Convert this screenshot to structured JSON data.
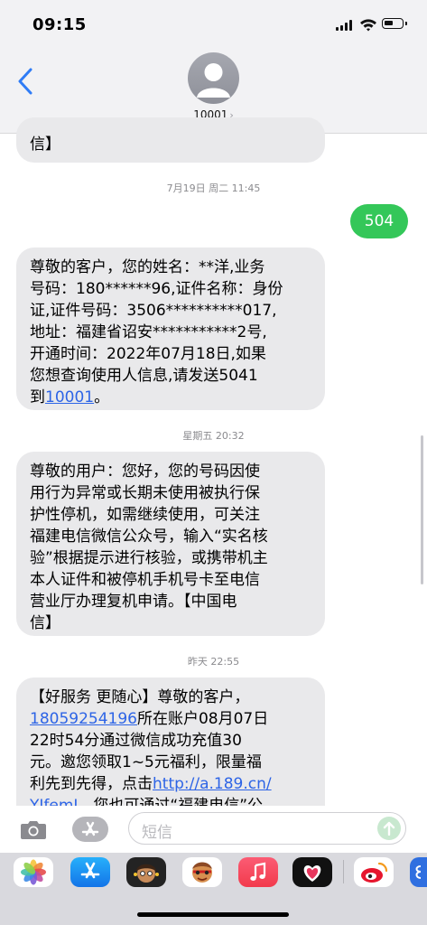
{
  "status_bar": {
    "time": "09:15"
  },
  "header": {
    "contact_name": "10001",
    "contact_chevron": "›"
  },
  "messages": {
    "partial_top": "信】",
    "timestamp_1": "7月19日 周二 11:45",
    "outgoing_1": "504",
    "incoming_1": {
      "lines": [
        "尊敬的客户，您的姓名：**洋,业务",
        "号码：180******96,证件名称：身份",
        "证,证件号码：3506**********017,",
        "地址：福建省诏安***********2号,",
        "开通时间：2022年07月18日,如果",
        "您想查询使用人信息,请发送5041"
      ],
      "last_prefix": "到",
      "last_link": "10001",
      "last_suffix": "。"
    },
    "timestamp_2": "星期五 20:32",
    "incoming_2": {
      "lines": [
        "尊敬的用户：您好，您的号码因使",
        "用行为异常或长期未使用被执行保",
        "护性停机，如需继续使用，可关注",
        "福建电信微信公众号，输入“实名核",
        "验”根据提示进行核验，或携带机主",
        "本人证件和被停机手机号卡至电信",
        "营业厅办理复机申请。【中国电",
        "信】"
      ]
    },
    "timestamp_3": "昨天 22:55",
    "incoming_3": {
      "line1": "【好服务 更随心】尊敬的客户，",
      "line2_link": "18059254196",
      "line2_text": "所在账户08月07日",
      "line3": "22时54分通过微信成功充值30",
      "line4": "元。邀您领取1~5元福利，限量福",
      "line5_text": "利先到先得，点击",
      "line5_link": "http://a.189.cn/",
      "line6_link": "YJfemI",
      "line6_text": "。您也可通过“福建电信”公"
    }
  },
  "input": {
    "placeholder": "短信"
  },
  "icons": {
    "back": "chevron-left-icon",
    "camera": "camera-icon",
    "appstore": "app-store-icon",
    "send": "send-arrow-icon"
  },
  "colors": {
    "link": "#2d64e6",
    "outgoing_bubble": "#34c759",
    "incoming_bubble": "#e9e9eb",
    "timestamp": "#8a8a8e"
  },
  "dock_apps": [
    "photos",
    "app-store",
    "memoji-1",
    "memoji-2",
    "music",
    "digital-touch",
    "weibo",
    "more"
  ]
}
